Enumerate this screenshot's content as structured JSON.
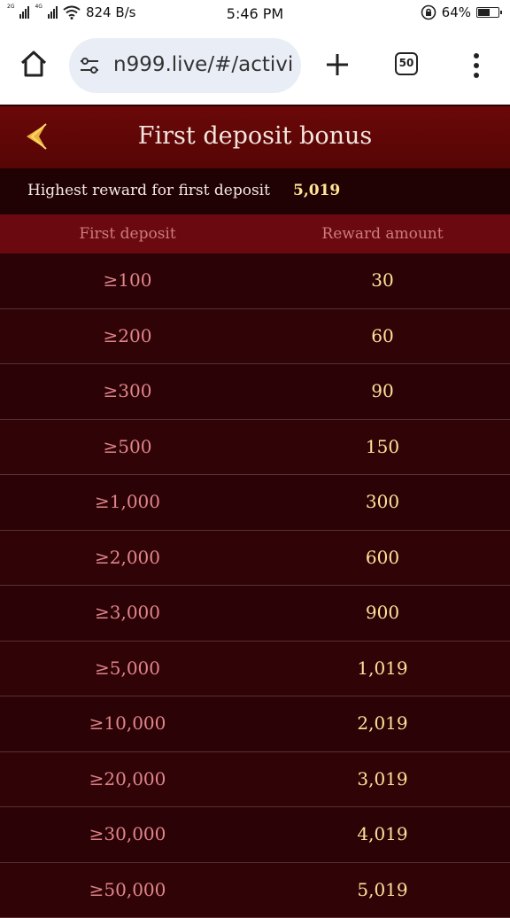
{
  "status_bar": {
    "net_speed": "824 B/s",
    "time": "5:46 PM",
    "battery": "64%",
    "battery_level": 0.64,
    "sim1_label": "2G",
    "sim2_label": "4G"
  },
  "browser": {
    "url": "n999.live/#/activi",
    "tab_count": "50"
  },
  "header": {
    "title": "First deposit bonus"
  },
  "highest": {
    "label": "Highest reward for first deposit",
    "value": "5,019"
  },
  "table": {
    "col_deposit": "First deposit",
    "col_reward": "Reward amount",
    "rows": [
      {
        "deposit": "≥100",
        "reward": "30"
      },
      {
        "deposit": "≥200",
        "reward": "60"
      },
      {
        "deposit": "≥300",
        "reward": "90"
      },
      {
        "deposit": "≥500",
        "reward": "150"
      },
      {
        "deposit": "≥1,000",
        "reward": "300"
      },
      {
        "deposit": "≥2,000",
        "reward": "600"
      },
      {
        "deposit": "≥3,000",
        "reward": "900"
      },
      {
        "deposit": "≥5,000",
        "reward": "1,019"
      },
      {
        "deposit": "≥10,000",
        "reward": "2,019"
      },
      {
        "deposit": "≥20,000",
        "reward": "3,019"
      },
      {
        "deposit": "≥30,000",
        "reward": "4,019"
      },
      {
        "deposit": "≥50,000",
        "reward": "5,019"
      }
    ]
  },
  "colors": {
    "header_bg": "#6b0808",
    "accent_gold": "#ffe493",
    "deposit_text": "#e0868a",
    "page_bg": "#2a0306"
  },
  "icons": {
    "home": "home-icon",
    "tune": "site-settings-icon",
    "plus": "new-tab-icon",
    "menu": "more-vert-icon",
    "back": "back-arrow-icon"
  }
}
